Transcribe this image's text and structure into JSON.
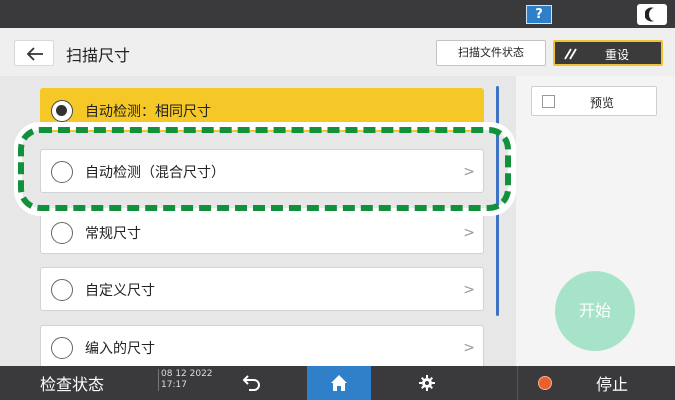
{
  "topbar": {
    "help_label": "?"
  },
  "header": {
    "title": "扫描尺寸",
    "scan_status_label": "扫描文件状态",
    "reset_label": "重设"
  },
  "options": [
    {
      "label": "自动检测：相同尺寸",
      "selected": true
    },
    {
      "label": "自动检测（混合尺寸）",
      "selected": false
    },
    {
      "label": "常规尺寸",
      "selected": false
    },
    {
      "label": "自定义尺寸",
      "selected": false
    },
    {
      "label": "编入的尺寸",
      "selected": false
    }
  ],
  "side": {
    "preview_label": "预览",
    "start_label": "开始"
  },
  "bottombar": {
    "check_status_label": "检查状态",
    "date": "08 12 2022",
    "time": "17:17",
    "stop_label": "停止"
  },
  "colors": {
    "selected": "#f5c827",
    "highlight": "#11913c",
    "accent_blue": "#2f80c8",
    "start_button": "#a6e3c9"
  }
}
